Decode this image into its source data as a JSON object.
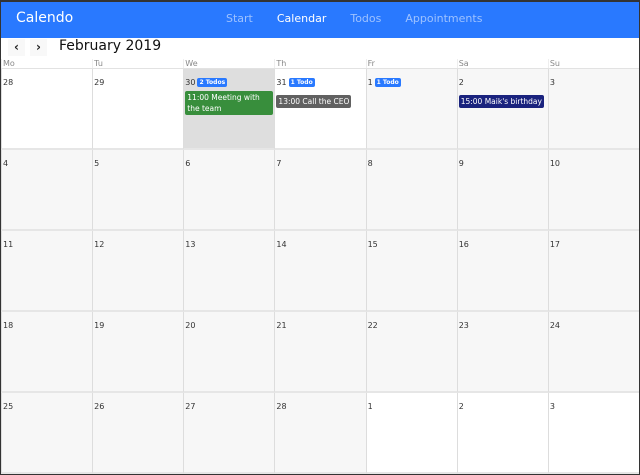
{
  "app": {
    "brand": "Calendo",
    "nav": [
      {
        "label": "Start",
        "active": false
      },
      {
        "label": "Calendar",
        "active": true
      },
      {
        "label": "Todos",
        "active": false
      },
      {
        "label": "Appointments",
        "active": false
      }
    ]
  },
  "toolbar": {
    "prev": "‹",
    "next": "›",
    "title": "February 2019"
  },
  "weekdays": [
    "Mo",
    "Tu",
    "We",
    "Th",
    "Fr",
    "Sa",
    "Su"
  ],
  "days": [
    {
      "d": "28",
      "type": "other"
    },
    {
      "d": "29",
      "type": "other"
    },
    {
      "d": "30",
      "type": "today",
      "badge": "2 Todos",
      "events": [
        {
          "text": "11:00 Meeting with the team",
          "color": "#388e3c"
        }
      ]
    },
    {
      "d": "31",
      "type": "other",
      "badge": "1 Todo",
      "events": [
        {
          "text": "13:00 Call the CEO",
          "color": "#616161"
        }
      ]
    },
    {
      "d": "1",
      "type": "cur",
      "badge": "1 Todo"
    },
    {
      "d": "2",
      "type": "cur",
      "events": [
        {
          "text": "15:00 Maik's birthday",
          "color": "#1a237e"
        }
      ]
    },
    {
      "d": "3",
      "type": "cur"
    },
    {
      "d": "4",
      "type": "cur"
    },
    {
      "d": "5",
      "type": "cur"
    },
    {
      "d": "6",
      "type": "cur"
    },
    {
      "d": "7",
      "type": "cur"
    },
    {
      "d": "8",
      "type": "cur"
    },
    {
      "d": "9",
      "type": "cur"
    },
    {
      "d": "10",
      "type": "cur"
    },
    {
      "d": "11",
      "type": "cur"
    },
    {
      "d": "12",
      "type": "cur"
    },
    {
      "d": "13",
      "type": "cur"
    },
    {
      "d": "14",
      "type": "cur"
    },
    {
      "d": "15",
      "type": "cur"
    },
    {
      "d": "16",
      "type": "cur"
    },
    {
      "d": "17",
      "type": "cur"
    },
    {
      "d": "18",
      "type": "cur"
    },
    {
      "d": "19",
      "type": "cur"
    },
    {
      "d": "20",
      "type": "cur"
    },
    {
      "d": "21",
      "type": "cur"
    },
    {
      "d": "22",
      "type": "cur"
    },
    {
      "d": "23",
      "type": "cur"
    },
    {
      "d": "24",
      "type": "cur"
    },
    {
      "d": "25",
      "type": "cur"
    },
    {
      "d": "26",
      "type": "cur"
    },
    {
      "d": "27",
      "type": "cur"
    },
    {
      "d": "28",
      "type": "cur"
    },
    {
      "d": "1",
      "type": "other"
    },
    {
      "d": "2",
      "type": "other"
    },
    {
      "d": "3",
      "type": "other"
    }
  ]
}
